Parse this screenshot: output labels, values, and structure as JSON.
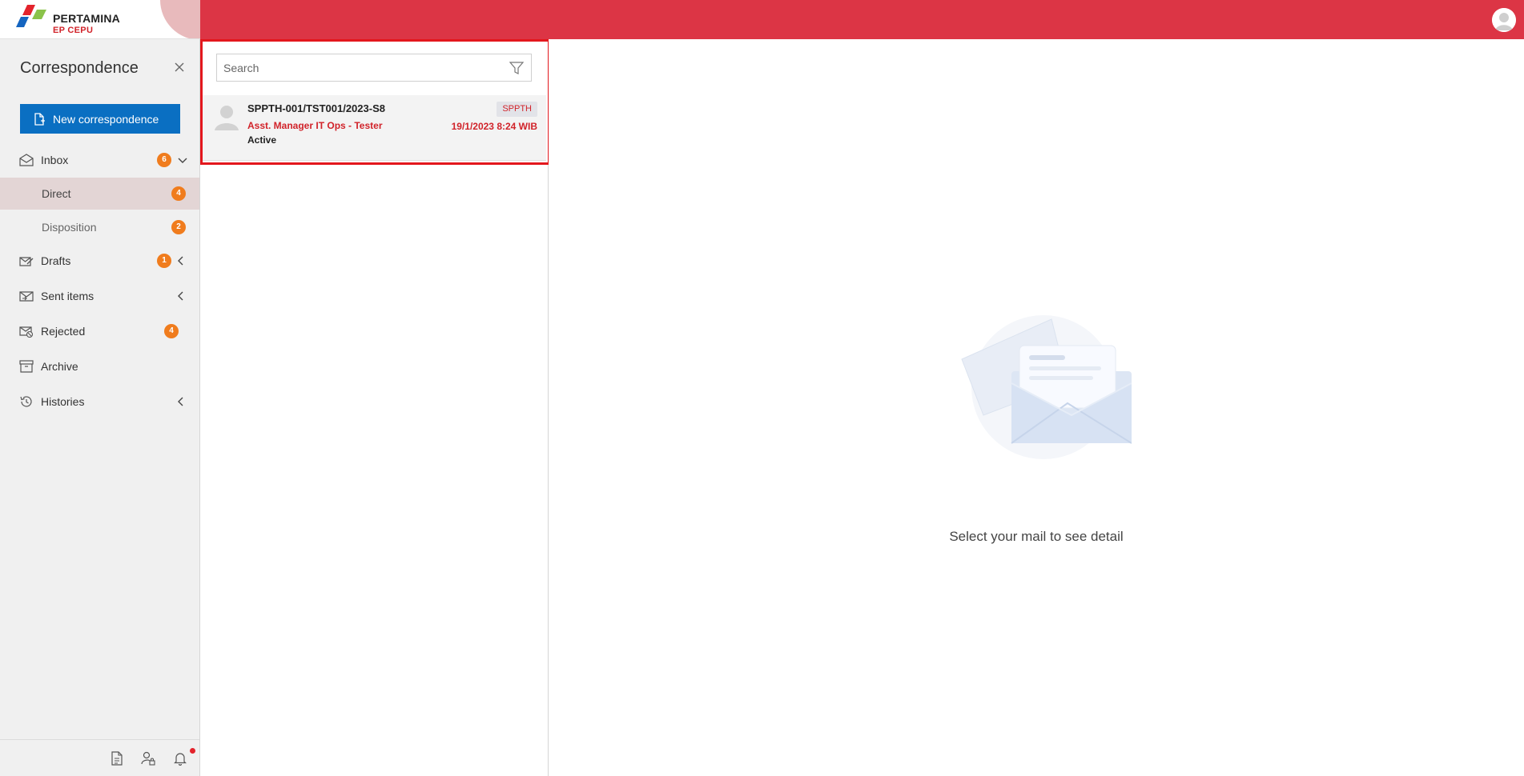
{
  "brand": {
    "name": "PERTAMINA",
    "subtitle": "EP CEPU"
  },
  "sidebar": {
    "title": "Correspondence",
    "new_button_label": "New correspondence",
    "items": [
      {
        "label": "Inbox",
        "badge": "6",
        "chevron": "down"
      },
      {
        "label": "Direct",
        "badge": "4",
        "active": true
      },
      {
        "label": "Disposition",
        "badge": "2"
      },
      {
        "label": "Drafts",
        "badge": "1",
        "chevron": "left"
      },
      {
        "label": "Sent items",
        "chevron": "left"
      },
      {
        "label": "Rejected",
        "badge": "4"
      },
      {
        "label": "Archive"
      },
      {
        "label": "Histories",
        "chevron": "left"
      }
    ]
  },
  "search": {
    "placeholder": "Search",
    "value": ""
  },
  "mail_list": [
    {
      "subject": "SPPTH-001/TST001/2023-S8",
      "sender": "Asst. Manager IT Ops - Tester",
      "status": "Active",
      "tag": "SPPTH",
      "date": "19/1/2023 8:24 WIB"
    }
  ],
  "detail": {
    "empty_message": "Select your mail to see detail"
  },
  "colors": {
    "topbar": "#dc3545",
    "accent": "#0a6fc2",
    "badge": "#f07c1d",
    "highlight": "#e3171d",
    "alert_text": "#d1232a"
  }
}
